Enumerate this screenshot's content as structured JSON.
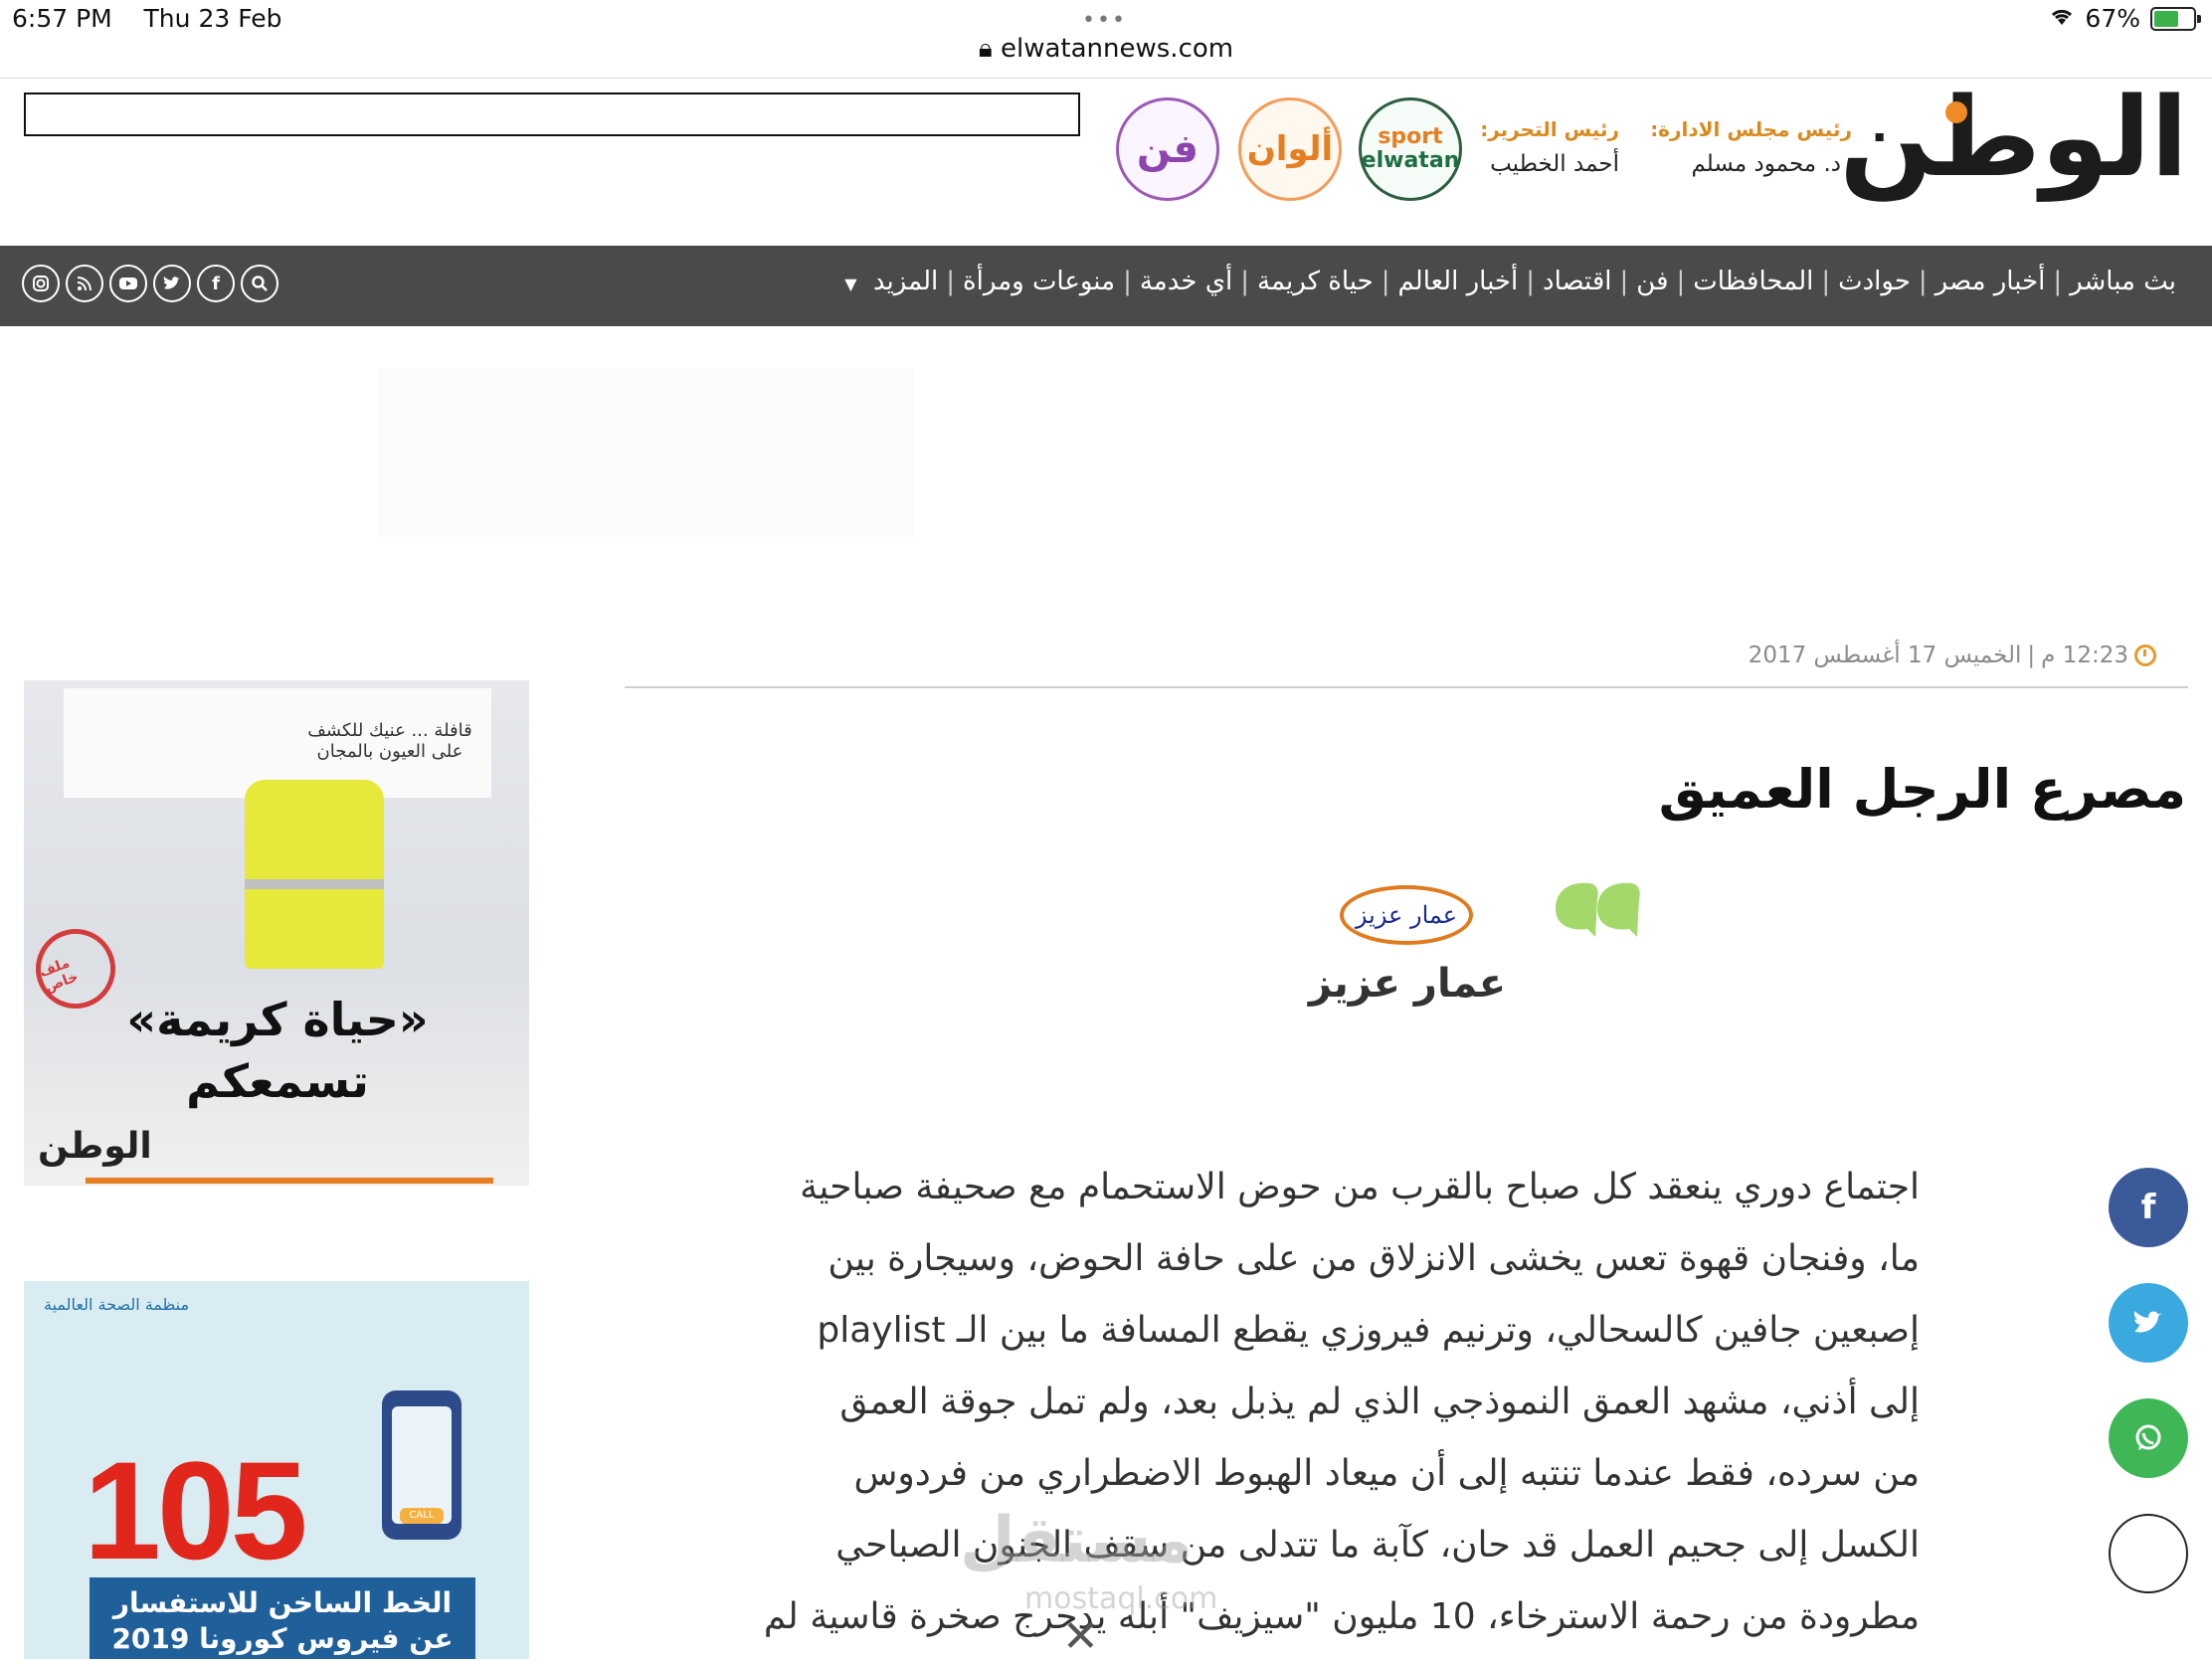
{
  "status_bar": {
    "time": "6:57 PM",
    "date": "Thu 23 Feb",
    "battery": "67%",
    "dots": "•••"
  },
  "browser": {
    "url": "elwatannews.com"
  },
  "header": {
    "site_logo": "الوطن",
    "partner_logos": [
      {
        "name": "fan",
        "text": "فن"
      },
      {
        "name": "alwan",
        "text": "ألوان"
      },
      {
        "name": "sport",
        "line1": "sport",
        "line2": "elwatan"
      }
    ],
    "editor_in_chief_label": "رئيس التحرير:",
    "editor_in_chief_name": "أحمد الخطيب",
    "board_chair_label": "رئيس مجلس الادارة:",
    "board_chair_name": "د. محمود مسلم"
  },
  "nav": {
    "items": [
      "بث مباشر",
      "أخبار مصر",
      "حوادث",
      "المحافظات",
      "فن",
      "اقتصاد",
      "أخبار العالم",
      "حياة كريمة",
      "أي خدمة",
      "منوعات ومرأة",
      "المزيد"
    ],
    "social_icons": [
      "search-icon",
      "facebook-icon",
      "twitter-icon",
      "youtube-icon",
      "rss-icon",
      "instagram-icon"
    ]
  },
  "article": {
    "time": "12:23 م",
    "date": "الخميس 17 أغسطس 2017",
    "title": "مصرع الرجل العميق",
    "author_logo_text": "عمار عزيز",
    "author_name": "عمار عزيز",
    "body_lines": [
      "اجتماع دوري ينعقد كل صباح بالقرب من حوض الاستحمام مع صحيفة صباحية",
      "ما، وفنجان قهوة تعس يخشى الانزلاق من على حافة الحوض، وسيجارة بين",
      "إصبعين جافين كالسحالي، وترنيم فيروزي يقطع المسافة ما بين الـ playlist",
      "إلى أذني، مشهد العمق النموذجي الذي لم يذبل بعد، ولم تمل جوقة العمق",
      "من سرده، فقط عندما تنتبه إلى أن ميعاد الهبوط الاضطراري من فردوس",
      "الكسل إلى جحيم العمل قد حان، كآبة ما تتدلى من سقف الجنون الصباحي",
      "مطرودة من رحمة الاسترخاء، 10 مليون \"سيزيف\" أبله يدحرج صخرة قاسية لم"
    ]
  },
  "watermark": {
    "text": "مستقل",
    "sub": "mostaql.com"
  },
  "share": {
    "facebook": "f",
    "twitter": "t",
    "whatsapp": "w"
  },
  "sidebar": {
    "ad1": {
      "banner": "قافلة ... عنيك للكشف على العيون بالمجان",
      "stamp": "ملف خاص",
      "title": "«حياة كريمة» تسمعكم",
      "logo": "الوطن"
    },
    "ad2": {
      "org": "منظمة الصحة العالمية",
      "number": "105",
      "call": "CALL",
      "text": "الخط الساخن للاستفسار عن فيروس كورونا 2019"
    }
  },
  "colors": {
    "nav_bg": "#4a4a4a",
    "accent_orange": "#e59a2a",
    "facebook": "#3b5a9a",
    "twitter": "#39a9e0",
    "whatsapp": "#3fb757"
  }
}
